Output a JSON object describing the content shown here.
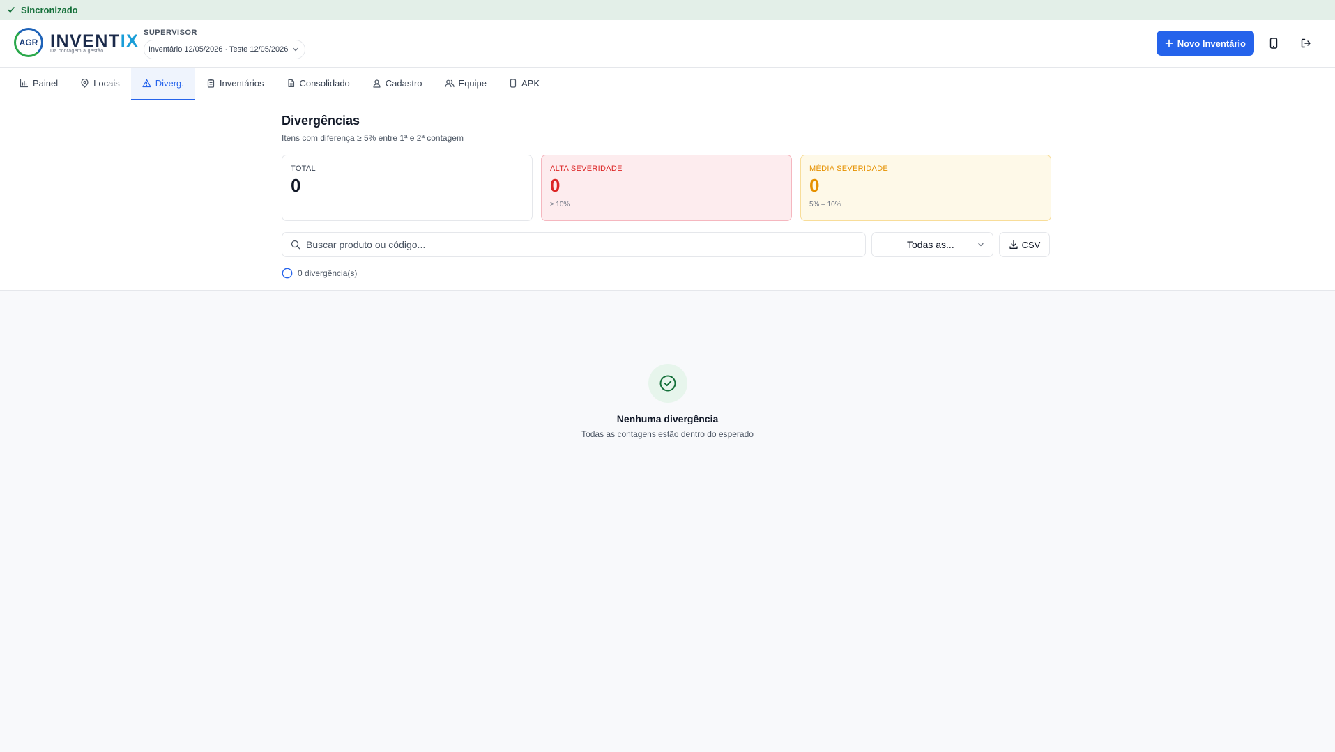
{
  "sync": {
    "status": "Sincronizado"
  },
  "header": {
    "logo_badge": "AGR",
    "brand_main": "INVENT",
    "brand_accent": "IX",
    "tagline": "Da contagem à gestão.",
    "role": "SUPERVISOR",
    "inventory": "Inventário 12/05/2026 · Teste 12/05/2026",
    "new_inventory_label": "Novo Inventário"
  },
  "tabs": [
    {
      "label": "Painel",
      "icon": "bar-chart-icon"
    },
    {
      "label": "Locais",
      "icon": "map-pin-icon"
    },
    {
      "label": "Diverg.",
      "icon": "warning-triangle-icon",
      "active": true
    },
    {
      "label": "Inventários",
      "icon": "clipboard-icon"
    },
    {
      "label": "Consolidado",
      "icon": "document-icon"
    },
    {
      "label": "Cadastro",
      "icon": "user-badge-icon"
    },
    {
      "label": "Equipe",
      "icon": "users-icon"
    },
    {
      "label": "APK",
      "icon": "phone-icon"
    }
  ],
  "page": {
    "title": "Divergências",
    "subtitle": "Itens com diferença ≥ 5% entre 1ª e 2ª contagem"
  },
  "cards": [
    {
      "label": "TOTAL",
      "value": "0",
      "note": ""
    },
    {
      "label": "ALTA SEVERIDADE",
      "value": "0",
      "note": "≥ 10%"
    },
    {
      "label": "MÉDIA SEVERIDADE",
      "value": "0",
      "note": "5% – 10%"
    }
  ],
  "filters": {
    "search_placeholder": "Buscar produto ou código...",
    "severity_selected": "Todas as...",
    "csv_label": "CSV"
  },
  "count_text": "0 divergência(s)",
  "empty": {
    "title": "Nenhuma divergência",
    "subtitle": "Todas as contagens estão dentro do esperado"
  },
  "colors": {
    "primary": "#2563eb",
    "success": "#15703a",
    "danger": "#dc2626",
    "warning": "#e69100"
  }
}
